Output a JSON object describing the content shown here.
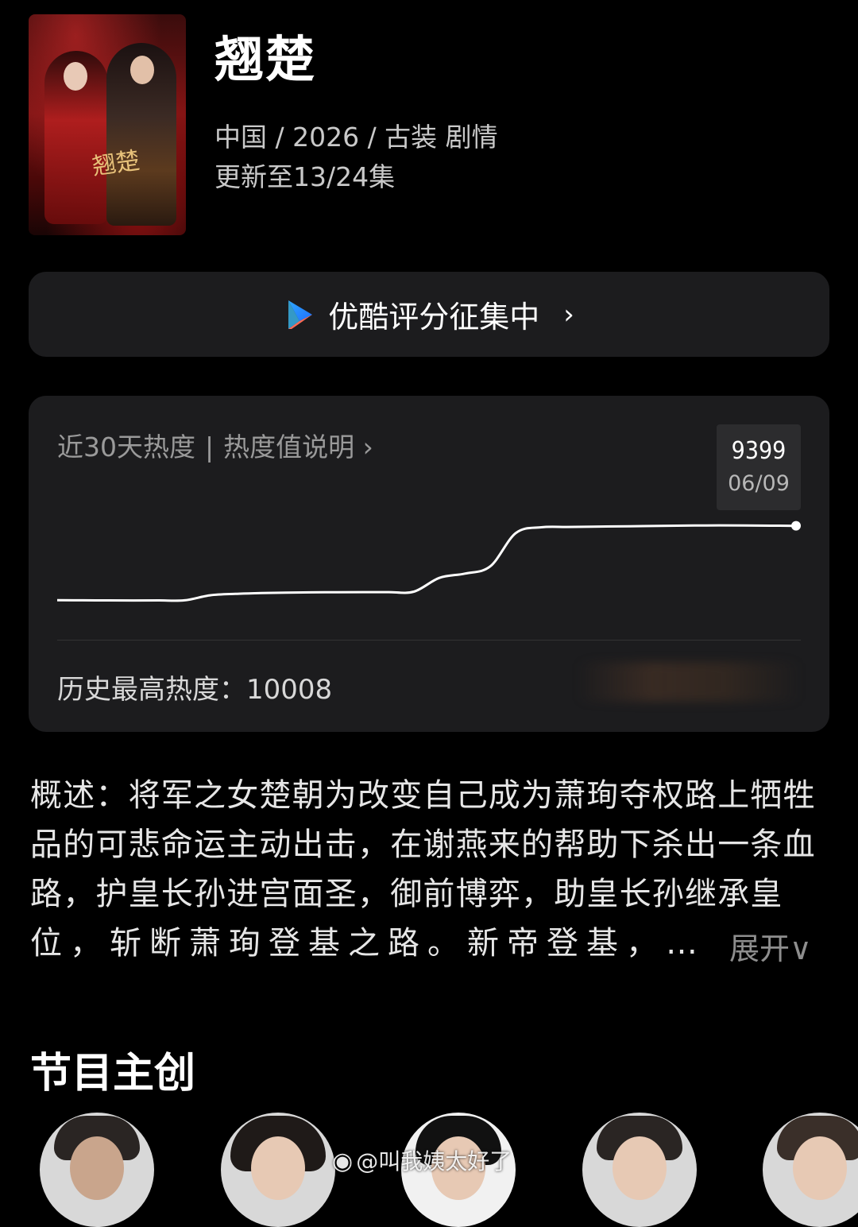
{
  "show": {
    "title": "翘楚",
    "meta": "中国 / 2026 / 古装 剧情",
    "update": "更新至13/24集",
    "poster_calligraphy": "翘楚"
  },
  "banner": {
    "label": "优酷评分征集中",
    "chevron": "›",
    "icon": "youku-logo-icon"
  },
  "heat": {
    "header_left": "近30天热度",
    "header_sep": "|",
    "header_link": "热度值说明 ›",
    "tooltip_value": "9399",
    "tooltip_date": "06/09",
    "peak_label": "历史最高热度：10008",
    "line_color": "#ffffff"
  },
  "chart_data": {
    "type": "line",
    "series": [
      {
        "values": [
          4260,
          4250,
          4245,
          4240,
          4245,
          4250,
          4600,
          4700,
          4750,
          4780,
          4800,
          4810,
          4820,
          4820,
          4850,
          5800,
          6100,
          6600,
          8900,
          9300,
          9320,
          9340,
          9360,
          9380,
          9400,
          9420,
          9430,
          9420,
          9410,
          9399
        ]
      }
    ],
    "grid": false
  },
  "synopsis": {
    "line1": "概述：将军之女楚朝为改变自己成为萧珣夺权路上牺牲",
    "line2": "品的可悲命运主动出击，在谢燕来的帮助下杀出一条血",
    "line3": "路，护皇长孙进宫面圣，御前博弈，助皇长孙继承皇",
    "line4": "位，斩断萧珣登基之路。新帝登基，…",
    "expand": "展开∨"
  },
  "creators": {
    "title": "节目主创"
  },
  "watermark": {
    "text": "@叫我姨太好了"
  }
}
